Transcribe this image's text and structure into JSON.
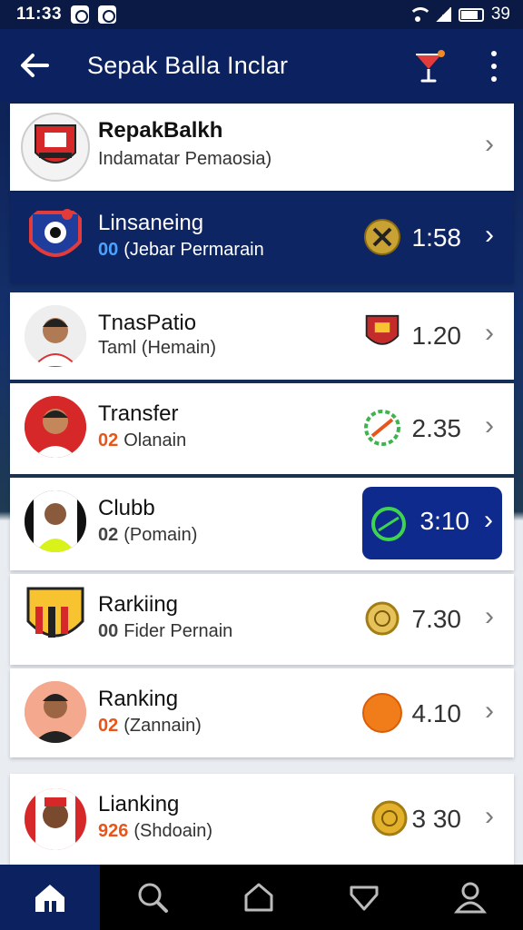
{
  "status_bar": {
    "time": "11:33",
    "battery": "39"
  },
  "app_bar": {
    "back_icon": "arrow-left-icon",
    "title": "Sepak Balla Inclar",
    "action_icon": "cocktail-icon",
    "menu_icon": "more-vert-icon"
  },
  "colors": {
    "primary": "#0c2160",
    "accent": "#0e2a8c",
    "orange": "#e8551a"
  },
  "items": [
    {
      "title": "RepakBalkh",
      "subtitle_num": "",
      "subtitle": "Indamatar Pemaosia)",
      "score": ""
    },
    {
      "title": "Linsaneing",
      "subtitle_num": "00",
      "subtitle": "(Jebar Permarain",
      "score": "1:58"
    },
    {
      "title": "TnasPatio",
      "subtitle_num": "",
      "subtitle": "Taml (Hemain)",
      "score": "1.20"
    },
    {
      "title": "Transfer",
      "subtitle_num": "02",
      "subtitle": "Olanain",
      "score": "2.35"
    },
    {
      "title": "Clubb",
      "subtitle_num": "02",
      "subtitle": "(Pomain)",
      "score": "3:10"
    },
    {
      "title": "Rarkiing",
      "subtitle_num": "00",
      "subtitle": "Fider Pernain",
      "score": "7.30"
    },
    {
      "title": "Ranking",
      "subtitle_num": "02",
      "subtitle": "(Zannain)",
      "score": "4.10"
    },
    {
      "title": "Lianking",
      "subtitle_num": "926",
      "subtitle": "(Shdoain)",
      "score": "3 30"
    }
  ],
  "bottom_nav": [
    {
      "icon": "home-icon"
    },
    {
      "icon": "search-icon"
    },
    {
      "icon": "home-outline-icon"
    },
    {
      "icon": "heart-icon"
    },
    {
      "icon": "profile-icon"
    }
  ]
}
